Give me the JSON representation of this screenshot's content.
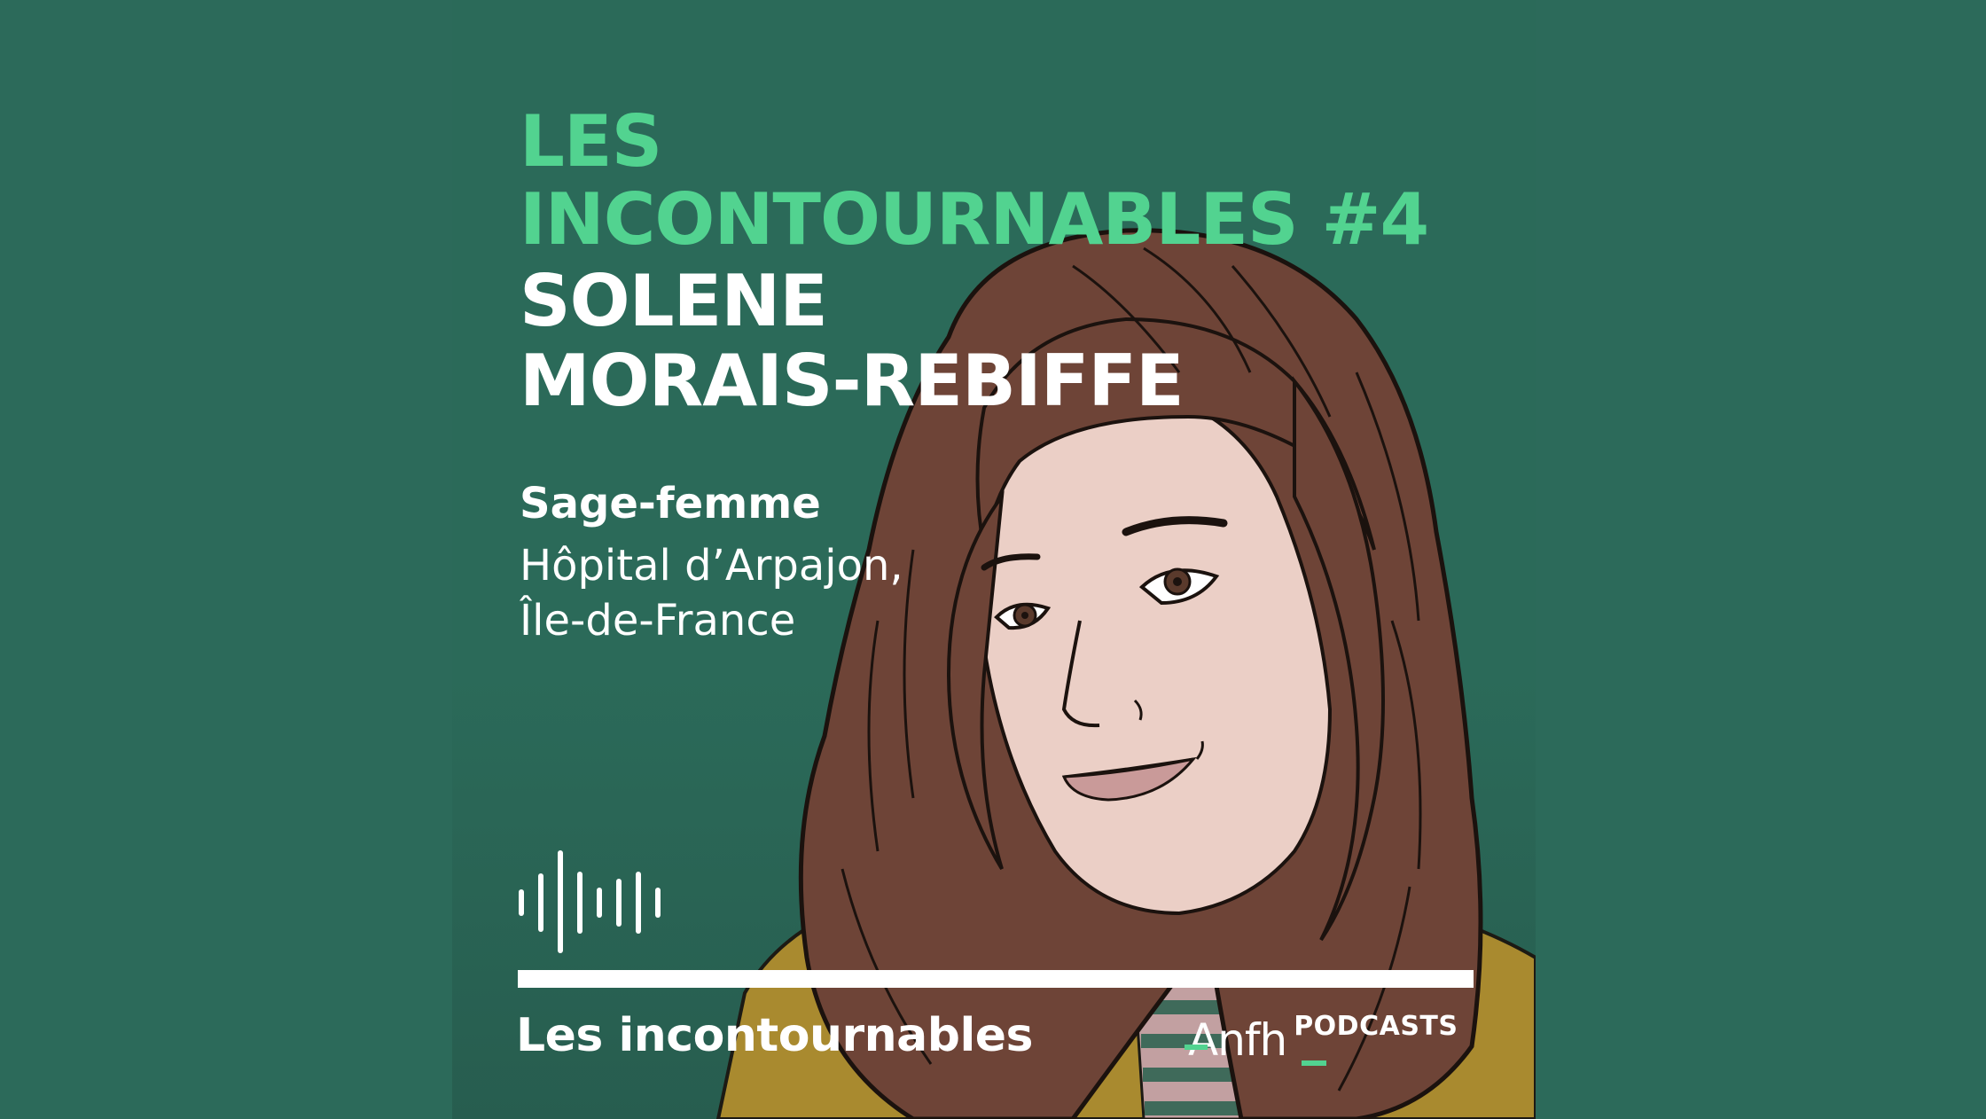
{
  "cover": {
    "title_line1": "LES",
    "title_line2": "INCONTOURNABLES #4",
    "name_line1": "SOLENE",
    "name_line2": "MORAIS-REBIFFE",
    "role": "Sage-femme",
    "place_line1": "Hôpital d’Arpajon,",
    "place_line2": "Île-de-France",
    "show_name": "Les incontournables",
    "brand_logo": "Anfh",
    "brand_suffix": "PODCASTS"
  },
  "colors": {
    "background": "#2c6a5a",
    "accent_green": "#52d390",
    "text_white": "#ffffff"
  },
  "icons": {
    "audio": "sound-wave-icon",
    "portrait": "illustrated-portrait"
  }
}
